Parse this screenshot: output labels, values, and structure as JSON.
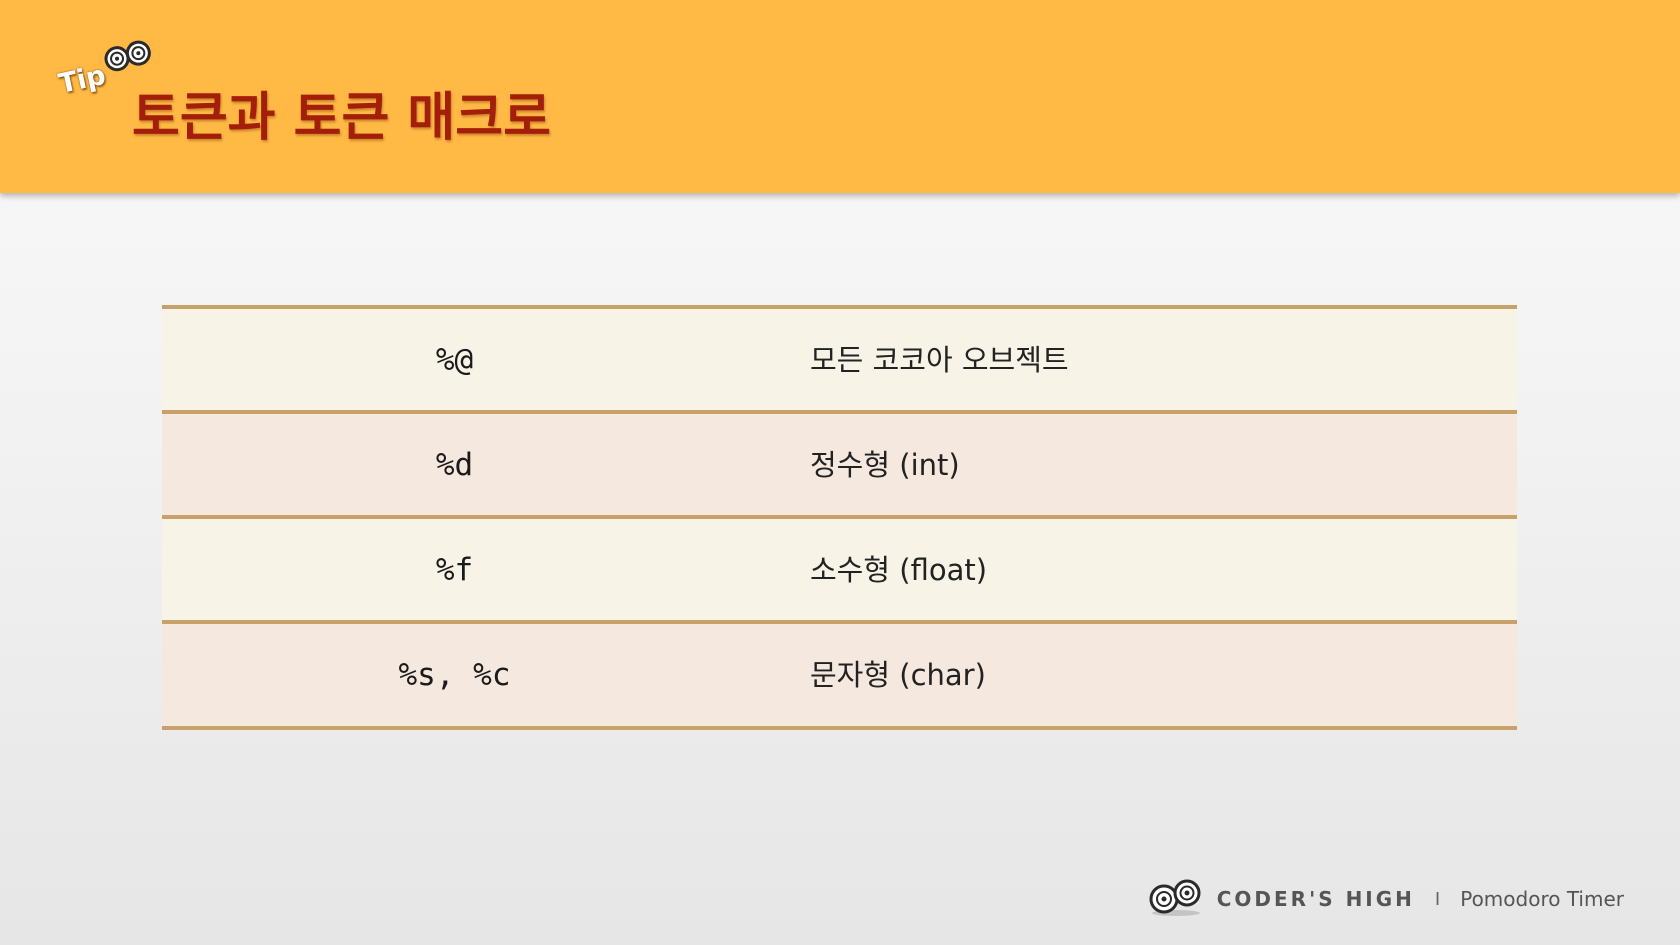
{
  "header": {
    "tip_label": "Tip",
    "title": "토큰과 토큰 매크로",
    "background_color": "#ffb944",
    "title_color": "#a31f0a",
    "tip_icon": "swirl-eyes-icon"
  },
  "table": {
    "rows": [
      {
        "key": "%@",
        "description": "모든 코코아 오브젝트"
      },
      {
        "key": "%d",
        "description": "정수형 (int)"
      },
      {
        "key": "%f",
        "description": "소수형 (float)"
      },
      {
        "key": "%s, %c",
        "description": "문자형 (char)"
      }
    ],
    "border_color": "#c8a06a",
    "row_colors": [
      "#f7f3e6",
      "#f5e8df"
    ]
  },
  "footer": {
    "brand": "CODER'S HIGH",
    "separator": "I",
    "subtitle": "Pomodoro Timer",
    "logo_icon": "swirl-eyes-icon"
  }
}
